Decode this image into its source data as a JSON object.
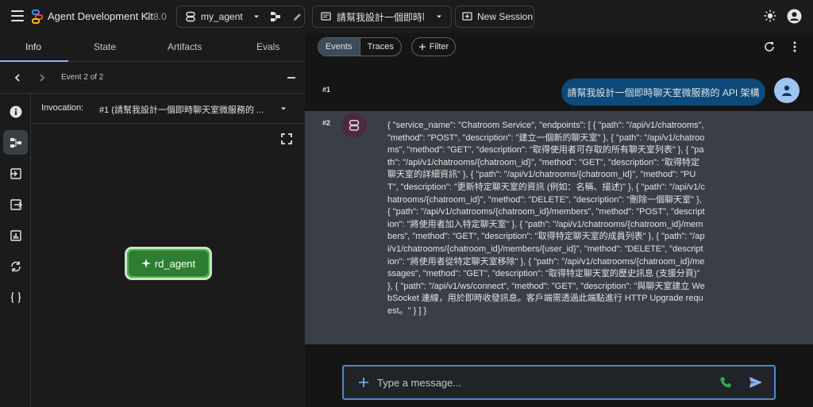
{
  "header": {
    "app_title": "Agent Development Kit",
    "version": "2.8.0",
    "agent_name": "my_agent",
    "session_title": "請幫我設計一個即時聊...",
    "new_session_label": "New Session"
  },
  "left_tabs": [
    {
      "label": "Info"
    },
    {
      "label": "State"
    },
    {
      "label": "Artifacts"
    },
    {
      "label": "Evals"
    }
  ],
  "event_nav": {
    "label": "Event 2 of 2"
  },
  "invocation": {
    "label": "Invocation:",
    "value": "#1 (請幫我設計一個即時聊天室微服務的 ..."
  },
  "graph": {
    "node_label": "rd_agent"
  },
  "toolbar": {
    "events_label": "Events",
    "traces_label": "Traces",
    "filter_label": "Filter"
  },
  "messages": [
    {
      "num": "#1",
      "text": "請幫我設計一個即時聊天室微服務的 API 架構"
    },
    {
      "num": "#2",
      "text": "{ \"service_name\": \"Chatroom Service\", \"endpoints\": [ { \"path\": \"/api/v1/chatrooms\", \"method\": \"POST\", \"description\": \"建立一個新的聊天室\" }, { \"path\": \"/api/v1/chatrooms\", \"method\": \"GET\", \"description\": \"取得使用者可存取的所有聊天室列表\" }, { \"path\": \"/api/v1/chatrooms/{chatroom_id}\", \"method\": \"GET\", \"description\": \"取得特定聊天室的詳細資訊\" }, { \"path\": \"/api/v1/chatrooms/{chatroom_id}\", \"method\": \"PUT\", \"description\": \"更新特定聊天室的資訊 (例如：名稱、描述)\" }, { \"path\": \"/api/v1/chatrooms/{chatroom_id}\", \"method\": \"DELETE\", \"description\": \"刪除一個聊天室\" }, { \"path\": \"/api/v1/chatrooms/{chatroom_id}/members\", \"method\": \"POST\", \"description\": \"將使用者加入特定聊天室\" }, { \"path\": \"/api/v1/chatrooms/{chatroom_id}/members\", \"method\": \"GET\", \"description\": \"取得特定聊天室的成員列表\" }, { \"path\": \"/api/v1/chatrooms/{chatroom_id}/members/{user_id}\", \"method\": \"DELETE\", \"description\": \"將使用者從特定聊天室移除\" }, { \"path\": \"/api/v1/chatrooms/{chatroom_id}/messages\", \"method\": \"GET\", \"description\": \"取得特定聊天室的歷史訊息 (支援分頁)\" }, { \"path\": \"/api/v1/ws/connect\", \"method\": \"GET\", \"description\": \"與聊天室建立 WebSocket 連線，用於即時收發訊息。客戶端需透過此端點進行 HTTP Upgrade request。\" } ] }"
    }
  ],
  "composer": {
    "placeholder": "Type a message..."
  },
  "colors": {
    "accent": "#8ab4f8",
    "node_fill": "#2e7d32",
    "user_bubble": "#0b4a7a",
    "phone": "#34a853"
  }
}
